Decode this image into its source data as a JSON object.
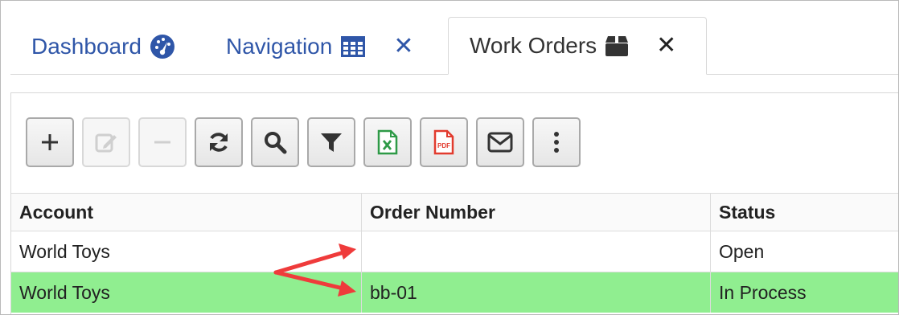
{
  "tabs": [
    {
      "label": "Dashboard",
      "icon": "dashboard-gauge-icon"
    },
    {
      "label": "Navigation",
      "icon": "grid-icon",
      "close": "✕"
    },
    {
      "label": "Work Orders",
      "icon": "box-icon",
      "close": "✕",
      "active": true
    }
  ],
  "toolbar": [
    {
      "name": "add",
      "icon": "plus-icon",
      "enabled": true
    },
    {
      "name": "edit",
      "icon": "edit-icon",
      "enabled": false
    },
    {
      "name": "delete",
      "icon": "minus-icon",
      "enabled": false
    },
    {
      "name": "refresh",
      "icon": "refresh-icon",
      "enabled": true
    },
    {
      "name": "search",
      "icon": "search-icon",
      "enabled": true
    },
    {
      "name": "filter",
      "icon": "filter-icon",
      "enabled": true
    },
    {
      "name": "export-excel",
      "icon": "excel-icon",
      "enabled": true
    },
    {
      "name": "export-pdf",
      "icon": "pdf-icon",
      "enabled": true,
      "icon_text": "PDF"
    },
    {
      "name": "email",
      "icon": "mail-icon",
      "enabled": true
    },
    {
      "name": "more",
      "icon": "more-vertical-icon",
      "enabled": true
    }
  ],
  "grid": {
    "columns": [
      "Account",
      "Order Number",
      "Status"
    ],
    "rows": [
      {
        "account": "World Toys",
        "order_number": "",
        "status": "Open",
        "selected": false
      },
      {
        "account": "World Toys",
        "order_number": "bb-01",
        "status": "In Process",
        "selected": true
      }
    ]
  },
  "colors": {
    "accent": "#2f56a8",
    "selected_row": "#90ee90",
    "annotation_arrow": "#ef3b3b"
  }
}
